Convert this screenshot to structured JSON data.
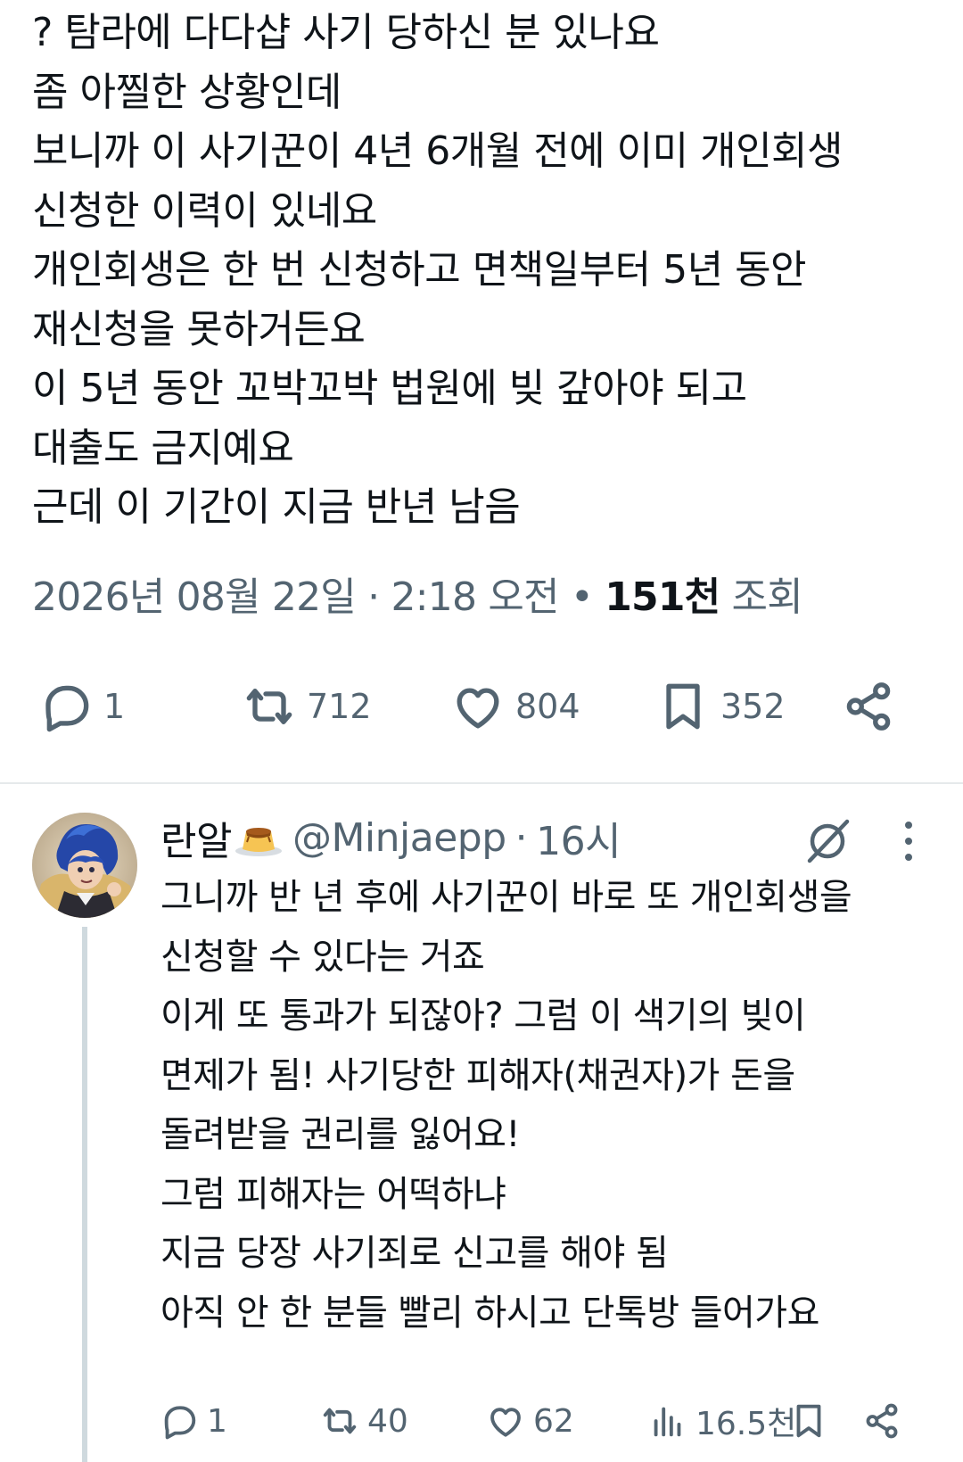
{
  "main_tweet": {
    "lines": [
      "? 탐라에 다다샵 사기 당하신 분 있나요",
      "좀 아찔한 상황인데",
      "보니까 이 사기꾼이 4년 6개월 전에 이미 개인회생",
      "신청한 이력이 있네요",
      "개인회생은 한 번 신청하고 면책일부터 5년 동안",
      "재신청을 못하거든요",
      "이 5년 동안 꼬박꼬박 법원에 빚 갚아야 되고",
      "대출도 금지예요",
      "근데 이 기간이 지금 반년 남음"
    ],
    "date": "2026년 08월 22일",
    "separator": "·",
    "time": "2:18 오전",
    "bullet": "•",
    "views_count": "151천",
    "views_label": "조회",
    "actions": {
      "replies": "1",
      "retweets": "712",
      "likes": "804",
      "bookmarks": "352"
    }
  },
  "reply": {
    "display_name": "란알",
    "handle": "@Minjaepp",
    "separator": "·",
    "time_ago": "16시",
    "lines": [
      "그니까 반 년 후에 사기꾼이 바로 또 개인회생을",
      "신청할 수 있다는 거죠",
      "이게 또 통과가 되잖아? 그럼 이 색기의 빚이",
      "면제가 됨! 사기당한 피해자(채권자)가 돈을",
      "돌려받을 권리를 잃어요!",
      "그럼 피해자는 어떡하냐",
      "지금 당장 사기죄로 신고를 해야 됨",
      "아직 안 한 분들 빨리 하시고 단톡방 들어가요"
    ],
    "actions": {
      "replies": "1",
      "retweets": "40",
      "likes": "62",
      "views": "16.5천"
    }
  },
  "icons": {
    "reply": "comment-bubble-icon",
    "retweet": "retweet-icon",
    "like": "heart-icon",
    "bookmark": "bookmark-icon",
    "share": "share-icon",
    "views": "bar-chart-icon",
    "grok": "grok-icon",
    "more": "more-vertical-icon",
    "flan": "pudding-emoji-icon"
  },
  "colors": {
    "text_primary": "#0f1419",
    "text_secondary": "#536471",
    "divider": "#e6e9eb",
    "thread_line": "#cfd9de"
  }
}
